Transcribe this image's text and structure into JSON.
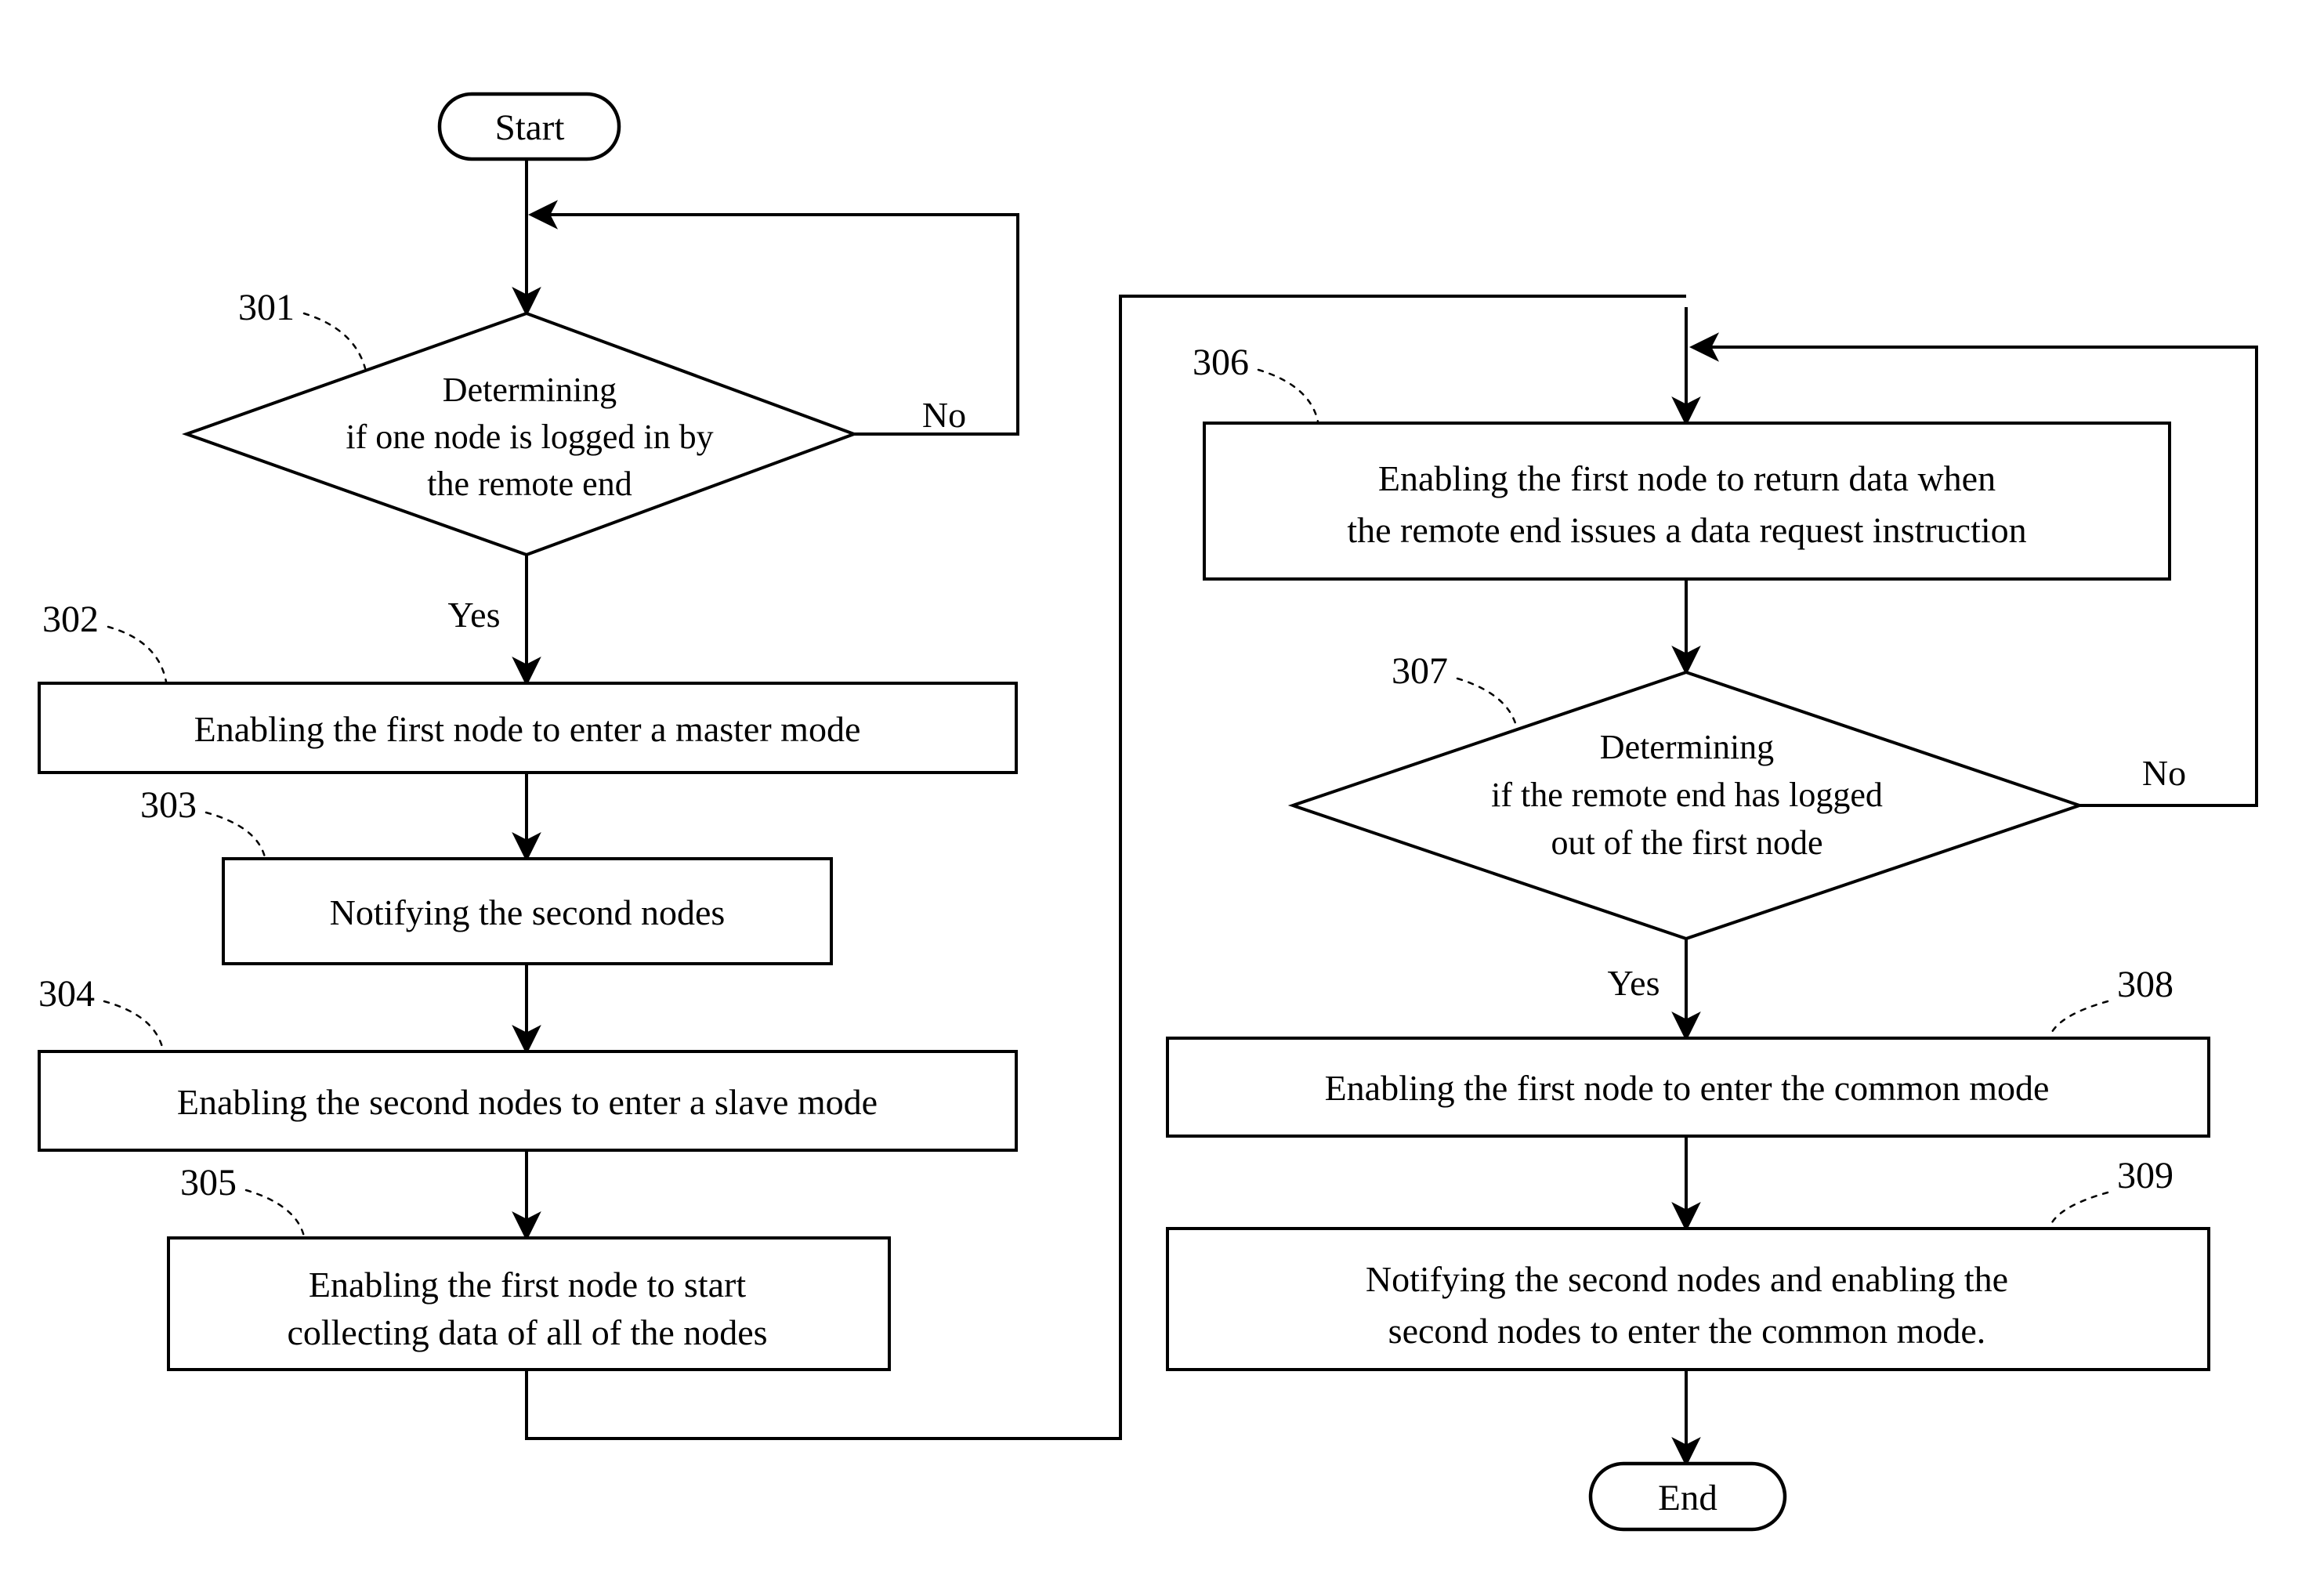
{
  "diagram": {
    "type": "flowchart",
    "title": "",
    "terminators": {
      "start": "Start",
      "end": "End"
    },
    "edge_labels": {
      "d301_no": "No",
      "d301_yes": "Yes",
      "d307_no": "No",
      "d307_yes": "Yes"
    },
    "reference_numerals": {
      "n301": "301",
      "n302": "302",
      "n303": "303",
      "n304": "304",
      "n305": "305",
      "n306": "306",
      "n307": "307",
      "n308": "308",
      "n309": "309"
    },
    "nodes": {
      "d301": {
        "shape": "decision",
        "ref": "301",
        "lines": [
          "Determining",
          "if one node is logged in by",
          "the remote end"
        ]
      },
      "p302": {
        "shape": "process",
        "ref": "302",
        "lines": [
          "Enabling the first node to enter a master mode"
        ]
      },
      "p303": {
        "shape": "process",
        "ref": "303",
        "lines": [
          "Notifying the second nodes"
        ]
      },
      "p304": {
        "shape": "process",
        "ref": "304",
        "lines": [
          "Enabling the second nodes to enter a slave mode"
        ]
      },
      "p305": {
        "shape": "process",
        "ref": "305",
        "lines": [
          "Enabling the first node to start",
          "collecting data of all of the nodes"
        ]
      },
      "p306": {
        "shape": "process",
        "ref": "306",
        "lines": [
          "Enabling the first node to return data when",
          "the remote end issues a data request instruction"
        ]
      },
      "d307": {
        "shape": "decision",
        "ref": "307",
        "lines": [
          "Determining",
          "if the remote end has logged",
          "out of the first node"
        ]
      },
      "p308": {
        "shape": "process",
        "ref": "308",
        "lines": [
          "Enabling the first node to enter the common mode"
        ]
      },
      "p309": {
        "shape": "process",
        "ref": "309",
        "lines": [
          "Notifying the second nodes and enabling the",
          "second nodes to enter the common mode."
        ]
      }
    },
    "colors": {
      "stroke": "#000000",
      "fill": "#ffffff",
      "background": "#ffffff"
    }
  }
}
